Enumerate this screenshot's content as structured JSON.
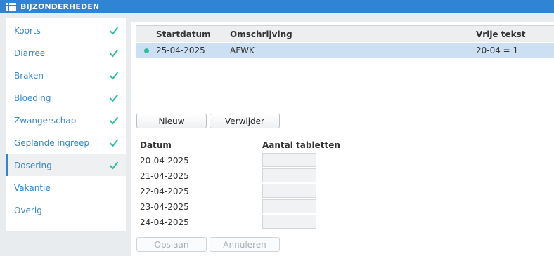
{
  "window": {
    "title": "BIJZONDERHEDEN",
    "icon": "list-icon"
  },
  "colors": {
    "titlebar": "#2f84d6",
    "link": "#3a87c4",
    "check": "#2cbfa3",
    "selected_row": "#cddff2"
  },
  "sidebar": {
    "items": [
      {
        "label": "Koorts",
        "checked": true
      },
      {
        "label": "Diarree",
        "checked": true
      },
      {
        "label": "Braken",
        "checked": true
      },
      {
        "label": "Bloeding",
        "checked": true
      },
      {
        "label": "Zwangerschap",
        "checked": true
      },
      {
        "label": "Geplande ingreep",
        "checked": true
      },
      {
        "label": "Dosering",
        "checked": true,
        "active": true
      },
      {
        "label": "Vakantie",
        "checked": false
      },
      {
        "label": "Overig",
        "checked": false
      }
    ]
  },
  "grid": {
    "headers": {
      "start": "Startdatum",
      "description": "Omschrijving",
      "free_text": "Vrije tekst"
    },
    "rows": [
      {
        "start": "25-04-2025",
        "description": "AFWK",
        "free_text": "20-04 = 1",
        "selected": true
      }
    ]
  },
  "buttons": {
    "new_label": "Nieuw",
    "delete_label": "Verwijder",
    "save_label": "Opslaan",
    "cancel_label": "Annuleren"
  },
  "dosage": {
    "date_header": "Datum",
    "tablets_header": "Aantal tabletten",
    "rows": [
      {
        "date": "20-04-2025",
        "tablets": ""
      },
      {
        "date": "21-04-2025",
        "tablets": ""
      },
      {
        "date": "22-04-2025",
        "tablets": ""
      },
      {
        "date": "23-04-2025",
        "tablets": ""
      },
      {
        "date": "24-04-2025",
        "tablets": ""
      }
    ]
  }
}
